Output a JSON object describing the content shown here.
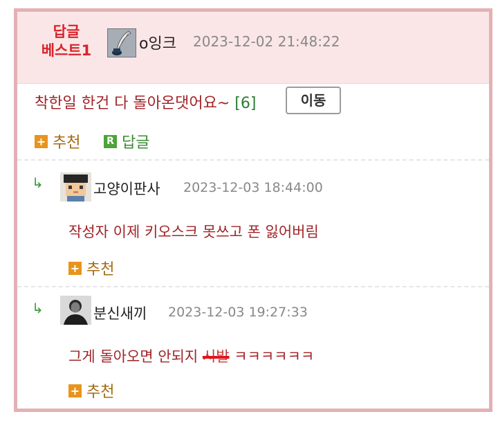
{
  "best_post": {
    "label_line1": "답글",
    "label_line2": "베스트1",
    "author": "o잉크",
    "timestamp": "2023-12-02 21:48:22",
    "body": "착한일 한건 다 돌아온댓어요~",
    "count": "[6]",
    "move_button": "이동",
    "recommend": "추천",
    "reply": "답글",
    "r_icon_glyph": "R",
    "plus_glyph": "+"
  },
  "comments": [
    {
      "arrow": "↳",
      "author": "고양이판사",
      "timestamp": "2023-12-03 18:44:00",
      "body": "작성자 이제 키오스크 못쓰고 폰 잃어버림",
      "recommend": "추천"
    },
    {
      "arrow": "↳",
      "author": "분신새끼",
      "timestamp": "2023-12-03 19:27:33",
      "body_prefix": "그게 돌아오면 안되지 ",
      "body_censored": "시발",
      "body_suffix": " ㅋㅋㅋㅋㅋㅋ",
      "recommend": "추천"
    }
  ],
  "colors": {
    "accent_red": "#d8232a",
    "comment_text": "#a12428",
    "header_bg": "#fbe6e7",
    "border_pink": "#e3b1b4",
    "reply_green": "#3d8a35",
    "plus_orange": "#e8941c"
  },
  "icons": {
    "author_icon": "quill-inkpot-icon",
    "comment1_avatar": "pixel-character-avatar",
    "comment2_avatar": "person-photo-avatar",
    "reply_arrow": "reply-arrow-icon"
  }
}
